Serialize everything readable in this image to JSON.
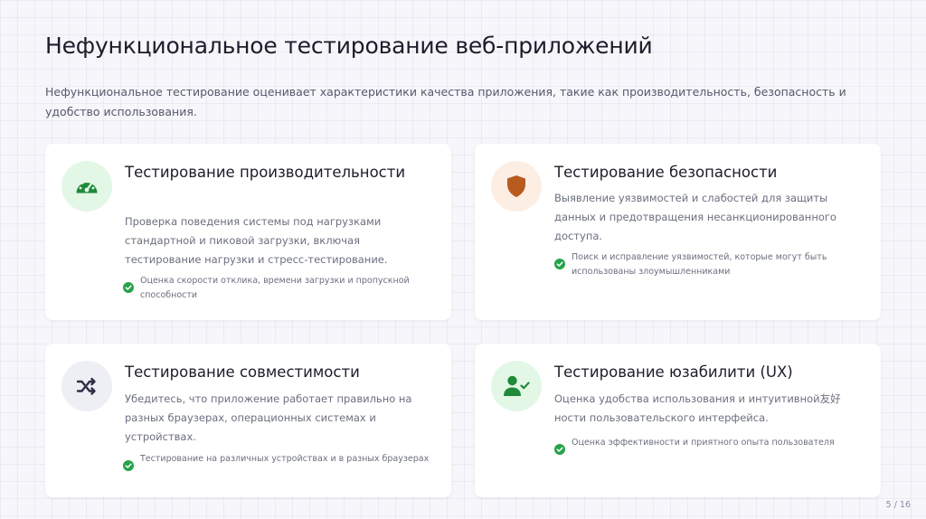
{
  "title": "Нефункциональное тестирование веб-приложений",
  "subtitle": "Нефункциональное тестирование оценивает характеристики качества приложения, такие как производительность, безопасность и удобство использования.",
  "cards": [
    {
      "icon": "speedometer-icon",
      "title": "Тестирование производительности",
      "description": "Проверка поведения системы под нагрузками стандартной и пиковой загрузки, включая тестирование нагрузки и стресс-тестирование.",
      "bullet": "Оценка скорости отклика, времени загрузки и пропускной способности"
    },
    {
      "icon": "shield-icon",
      "title": "Тестирование безопасности",
      "description": "Выявление уязвимостей и слабостей для защиты данных и предотвращения несанкционированного доступа.",
      "bullet": "Поиск и исправление уязвимостей, которые могут быть использованы злоумышленниками"
    },
    {
      "icon": "shuffle-icon",
      "title": "Тестирование совместимости",
      "description": "Убедитесь, что приложение работает правильно на разных браузерах, операционных системах и устройствах.",
      "bullet": "Тестирование на различных устройствах и в разных браузерах"
    },
    {
      "icon": "user-check-icon",
      "title": "Тестирование юзабилити (UX)",
      "description": "Оценка удобства использования и интуитивной友好ности пользовательского интерфейса.",
      "bullet": "Оценка эффективности и приятного опыта пользователя"
    }
  ],
  "colors": {
    "accent_green": "#1e8a3a",
    "check_green": "#27a34a",
    "shield_brown": "#b95a1f",
    "icon_dark": "#2c2f45"
  },
  "page_number": "5 / 16"
}
